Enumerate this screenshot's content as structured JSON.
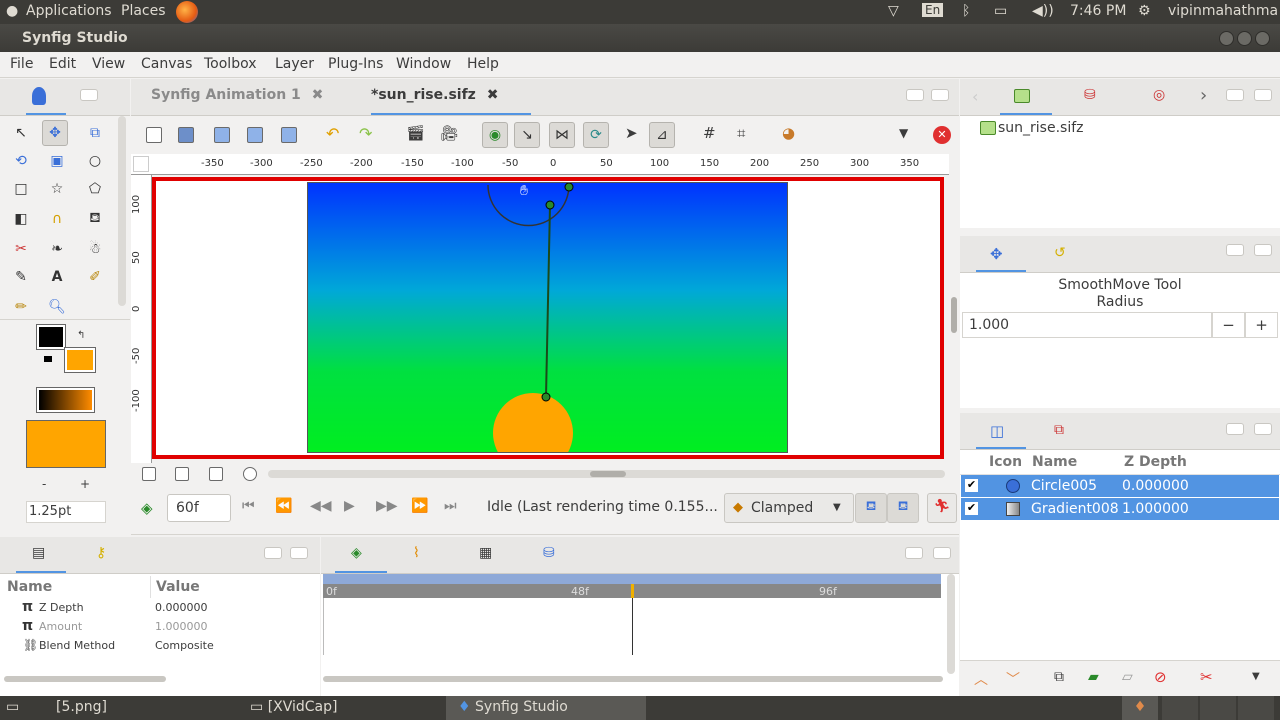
{
  "system_bar": {
    "applications": "Applications",
    "places": "Places",
    "lang": "En",
    "time": "7:46 PM",
    "user": "vipinmahathma"
  },
  "window": {
    "title": "Synfig Studio"
  },
  "menu": [
    "File",
    "Edit",
    "View",
    "Canvas",
    "Toolbox",
    "Layer",
    "Plug-Ins",
    "Window",
    "Help"
  ],
  "tabs": [
    {
      "label": "Synfig Animation 1"
    },
    {
      "label": "*sun_rise.sifz"
    }
  ],
  "ruler": {
    "h_ticks": [
      "-350",
      "-300",
      "-250",
      "-200",
      "-150",
      "-100",
      "-50",
      "0",
      "50",
      "100",
      "150",
      "200",
      "250",
      "300",
      "350"
    ],
    "v_ticks": [
      "100",
      "50",
      "0",
      "-50",
      "-100"
    ]
  },
  "toolbox": {
    "brush_size": "1.25pt",
    "minus": "-",
    "plus": "+"
  },
  "playback": {
    "current_frame": "60f",
    "status": "Idle (Last rendering time 0.155...",
    "interpolation": "Clamped"
  },
  "canvas_browser": {
    "file": "sun_rise.sifz"
  },
  "tool_options": {
    "title": "SmoothMove Tool",
    "radius_label": "Radius",
    "radius_value": "1.000",
    "minus": "−",
    "plus": "+"
  },
  "layers": {
    "headers": {
      "icon": "Icon",
      "name": "Name",
      "zdepth": "Z Depth"
    },
    "rows": [
      {
        "name": "Circle005",
        "zdepth": "0.000000"
      },
      {
        "name": "Gradient008",
        "zdepth": "1.000000"
      }
    ]
  },
  "params": {
    "headers": {
      "name": "Name",
      "value": "Value"
    },
    "rows": [
      {
        "name": "Z Depth",
        "value": "0.000000"
      },
      {
        "name": "Amount",
        "value": "1.000000"
      },
      {
        "name": "Blend Method",
        "value": "Composite"
      }
    ]
  },
  "timeline": {
    "marks": [
      "0f",
      "48f",
      "96f"
    ]
  },
  "taskbar": [
    "[5.png]",
    "[XVidCap]",
    "Synfig Studio"
  ],
  "colors": {
    "accent_selection": "#5294e2",
    "canvas_border": "#e00000",
    "sun": "#ffa500",
    "outline_color": "#000000",
    "fill_color": "#ffa500"
  }
}
